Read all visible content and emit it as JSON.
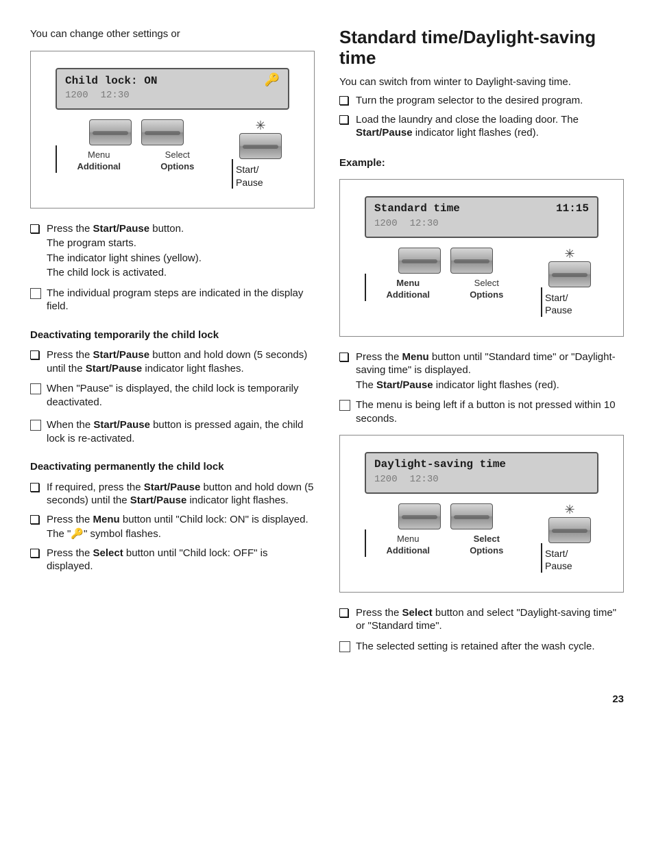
{
  "page_number": "23",
  "left": {
    "intro": "You can change other settings or",
    "panel1": {
      "lcd_line1_left": "Child lock: ON",
      "lcd_line1_right_key": "🔑",
      "lcd_line2_a": "1200",
      "lcd_line2_b": "12:30",
      "menu_l1": "Menu",
      "menu_l2": "Additional",
      "select_l1": "Select",
      "select_l2": "Options",
      "snow": "✳",
      "start_l1": "Start/",
      "start_l2": "Pause"
    },
    "step1_a": "Press the ",
    "step1_b": "Start/Pause",
    "step1_c": " button.",
    "step1_p2": "The program starts.",
    "step1_p3": "The indicator light shines (yellow).",
    "step1_p4": "The child lock is activated.",
    "note1": "The individual program steps are indicated in the display field.",
    "h_temp": "Deactivating temporarily the child lock",
    "temp_a": "Press the ",
    "temp_b": "Start/Pause",
    "temp_c": " button and hold down (5 seconds) until the ",
    "temp_d": "Start/Pause",
    "temp_e": " indicator light flashes.",
    "note2": "When \"Pause\" is displayed, the child lock is temporarily deactivated.",
    "note3_a": "When the ",
    "note3_b": "Start/Pause",
    "note3_c": " button is pressed again, the child lock is re-activated.",
    "h_perm": "Deactivating permanently the child lock",
    "perm1_a": "If required, press the ",
    "perm1_b": "Start/Pause",
    "perm1_c": " button and hold down (5 seconds) until the ",
    "perm1_d": "Start/Pause",
    "perm1_e": " indicator light flashes.",
    "perm2_a": "Press the ",
    "perm2_b": "Menu",
    "perm2_c": " button until \"Child lock: ON\" is displayed.",
    "perm2_p2": "The \"🔑\" symbol flashes.",
    "perm3_a": "Press the ",
    "perm3_b": "Select",
    "perm3_c": " button until \"Child lock: OFF\" is displayed."
  },
  "right": {
    "heading": "Standard time/Daylight-saving time",
    "intro": "You can switch from winter to Daylight-saving time.",
    "step1": "Turn the program selector to the desired program.",
    "step2_a": "Load the laundry and close the loading door. The ",
    "step2_b": "Start/Pause",
    "step2_c": " indicator light flashes (red).",
    "example_h": "Example:",
    "panel2": {
      "lcd_line1_left": "Standard time",
      "lcd_line1_right": "11:15",
      "lcd_line2_a": "1200",
      "lcd_line2_b": "12:30",
      "menu_l1": "Menu",
      "menu_l2": "Additional",
      "select_l1": "Select",
      "select_l2": "Options",
      "snow": "✳",
      "start_l1": "Start/",
      "start_l2": "Pause"
    },
    "step3_a": "Press the ",
    "step3_b": "Menu",
    "step3_c": " button until \"Standard time\" or \"Daylight-saving time\" is displayed.",
    "step3_p2_a": "The ",
    "step3_p2_b": "Start/Pause",
    "step3_p2_c": " indicator light flashes (red).",
    "note4": "The menu is being left if a button is not pressed within 10 seconds.",
    "panel3": {
      "lcd_line1_left": "Daylight-saving time",
      "lcd_line1_right": "",
      "lcd_line2_a": "1200",
      "lcd_line2_b": "12:30",
      "menu_l1": "Menu",
      "menu_l2": "Additional",
      "select_l1": "Select",
      "select_l2": "Options",
      "snow": "✳",
      "start_l1": "Start/",
      "start_l2": "Pause"
    },
    "step4_a": "Press the ",
    "step4_b": "Select",
    "step4_c": " button and select \"Daylight-saving time\" or \"Standard time\".",
    "note5": "The selected setting is retained after the wash cycle."
  }
}
